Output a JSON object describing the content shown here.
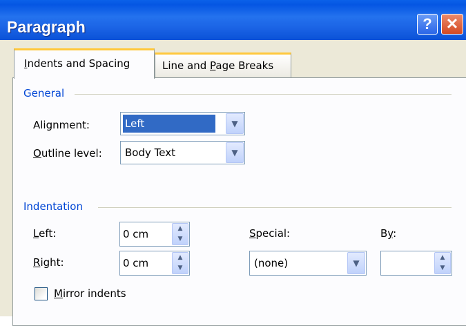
{
  "window": {
    "title": "Paragraph",
    "help_label": "?",
    "close_label": "✕"
  },
  "tabs": [
    {
      "label_pre": "",
      "label_u": "I",
      "label_post": "ndents and Spacing",
      "active": true
    },
    {
      "label_pre": "Line and ",
      "label_u": "P",
      "label_post": "age Breaks",
      "active": false
    }
  ],
  "general": {
    "heading": "General",
    "alignment": {
      "label_pre": "Alignment:",
      "label_u": "",
      "label_post": "",
      "value": "Left"
    },
    "outline_level": {
      "label_pre": "",
      "label_u": "O",
      "label_post": "utline level:",
      "value": "Body Text"
    }
  },
  "indentation": {
    "heading": "Indentation",
    "left": {
      "label_pre": "",
      "label_u": "L",
      "label_post": "eft:",
      "value": "0 cm"
    },
    "right": {
      "label_pre": "",
      "label_u": "R",
      "label_post": "ight:",
      "value": "0 cm"
    },
    "special": {
      "label_pre": "",
      "label_u": "S",
      "label_post": "pecial:",
      "value": "(none)"
    },
    "by": {
      "label_pre": "B",
      "label_u": "y",
      "label_post": ":",
      "value": ""
    },
    "mirror": {
      "label_pre": "",
      "label_u": "M",
      "label_post": "irror indents",
      "checked": false
    }
  },
  "icons": {
    "dropdown": "chevron-down-icon",
    "spin_up": "spin-up-icon",
    "spin_down": "spin-down-icon"
  },
  "colors": {
    "title_bar": "#0a5fe6",
    "dialog_bg": "#ece9d8",
    "group_heading": "#0046d5",
    "selection": "#316ac5",
    "tab_highlight": "#ffc83c",
    "close_button": "#d44a23"
  }
}
